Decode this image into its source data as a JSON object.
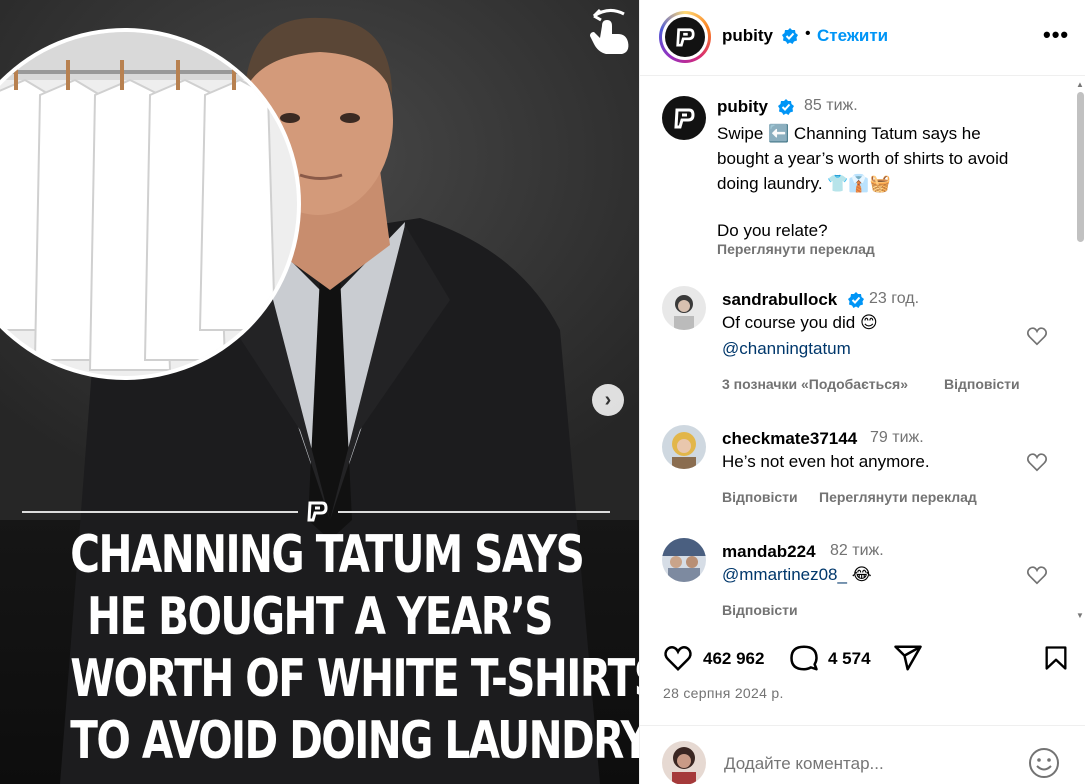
{
  "post": {
    "headline_lines": [
      "CHANNING TATUM SAYS",
      "HE BOUGHT A YEAR’S",
      "WORTH OF WHITE T-SHIRTS",
      "TO AVOID DOING LAUNDRY"
    ],
    "next_arrow": "›"
  },
  "header": {
    "username": "pubity",
    "dot": "•",
    "follow_label": "Стежити",
    "more_label": "•••"
  },
  "caption": {
    "username": "pubity",
    "time": "85 тиж.",
    "lines": [
      "Swipe ⬅️ Channing Tatum says he",
      "bought a year’s worth of shirts to avoid",
      "doing laundry. 👕👔🧺"
    ],
    "question": "Do you relate?",
    "translate_label": "Переглянути переклад"
  },
  "comments": [
    {
      "username": "sandrabullock",
      "verified": true,
      "time": "23 год.",
      "text_line1": "Of course you did 😊",
      "mention": "@channingtatum",
      "likes_label": "3 позначки «Подобається»",
      "reply_label": "Відповісти"
    },
    {
      "username": "checkmate37144",
      "time": "79 тиж.",
      "text": "He’s not even hot anymore.",
      "reply_label": "Відповісти",
      "translate_label": "Переглянути переклад"
    },
    {
      "username": "mandab224",
      "time": "82 тиж.",
      "mention": "@mmartinez08_",
      "emoji": "😂",
      "reply_label": "Відповісти"
    }
  ],
  "stats": {
    "likes": "462 962",
    "comments": "4 574",
    "date": "28 серпня 2024 р."
  },
  "add_comment": {
    "placeholder": "Додайте коментар..."
  },
  "colors": {
    "link_blue": "#0095f6",
    "mention": "#00376b",
    "secondary_text": "#737373",
    "verified_blue": "#0095f6"
  },
  "icons": [
    "swipe-hand-icon",
    "chevron-right-icon",
    "verified-badge-icon",
    "more-icon",
    "heart-icon",
    "comment-icon",
    "share-icon",
    "bookmark-icon",
    "emoji-icon"
  ]
}
